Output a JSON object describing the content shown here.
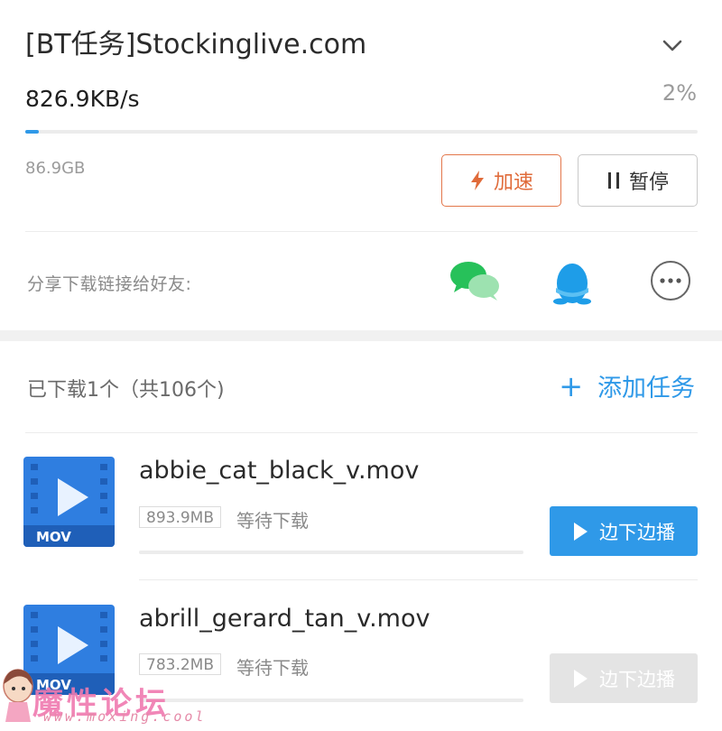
{
  "task": {
    "title": "[BT任务]Stockinglive.com",
    "speed": "826.9KB/s",
    "percent": "2%",
    "progress_fraction": 0.02,
    "total_size": "86.9GB",
    "accelerate_label": "加速",
    "pause_label": "暂停",
    "collapse_icon": "chevron-down-icon"
  },
  "share": {
    "label": "分享下载链接给好友:",
    "targets": [
      "wechat-icon",
      "qq-icon",
      "more-icon"
    ]
  },
  "list_header": {
    "count_text": "已下载1个（共106个)",
    "add_task_label": "添加任务"
  },
  "files": [
    {
      "name": "abbie_cat_black_v.mov",
      "ext": "MOV",
      "size": "893.9MB",
      "status": "等待下载",
      "play_label": "边下边播",
      "play_enabled": true
    },
    {
      "name": "abrill_gerard_tan_v.mov",
      "ext": "MOV",
      "size": "783.2MB",
      "status": "等待下载",
      "play_label": "边下边播",
      "play_enabled": false
    }
  ],
  "watermark": {
    "text": "魔性论坛",
    "url": "www.moxing.cool"
  },
  "colors": {
    "accent": "#2f99e8",
    "accelerate": "#e06b3a",
    "file_icon": "#2f7ee0"
  }
}
